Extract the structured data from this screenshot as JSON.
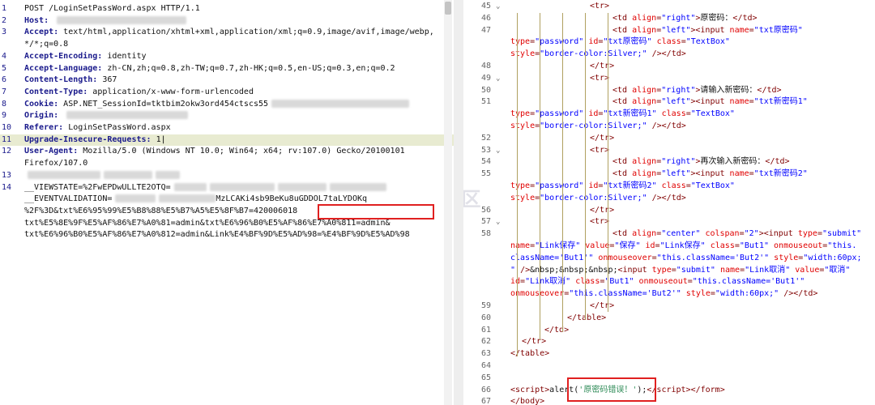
{
  "request": {
    "lines": [
      {
        "n": "1",
        "segments": [
          {
            "k": "",
            "v": "POST /LoginSetPassWord.aspx HTTP/1.1"
          }
        ]
      },
      {
        "n": "2",
        "segments": [
          {
            "k": "Host: ",
            "v": ""
          }
        ]
      },
      {
        "n": "3",
        "segments": [
          {
            "k": "Accept: ",
            "v": "text/html,application/xhtml+xml,application/xml;q=0.9,image/avif,image/webp,"
          }
        ]
      },
      {
        "n": "",
        "segments": [
          {
            "k": "",
            "v": "*/*;q=0.8"
          }
        ]
      },
      {
        "n": "4",
        "segments": [
          {
            "k": "Accept-Encoding: ",
            "v": "identity"
          }
        ]
      },
      {
        "n": "5",
        "segments": [
          {
            "k": "Accept-Language: ",
            "v": "zh-CN,zh;q=0.8,zh-TW;q=0.7,zh-HK;q=0.5,en-US;q=0.3,en;q=0.2"
          }
        ]
      },
      {
        "n": "6",
        "segments": [
          {
            "k": "Content-Length: ",
            "v": "367"
          }
        ]
      },
      {
        "n": "7",
        "segments": [
          {
            "k": "Content-Type: ",
            "v": "application/x-www-form-urlencoded"
          }
        ]
      },
      {
        "n": "8",
        "segments": [
          {
            "k": "Cookie: ",
            "v": "ASP.NET_SessionId=tktbim2okw3ord454ctscs55"
          }
        ]
      },
      {
        "n": "9",
        "segments": [
          {
            "k": "Origin: ",
            "v": ""
          }
        ]
      },
      {
        "n": "10",
        "segments": [
          {
            "k": "Referer: ",
            "v": ""
          }
        ],
        "suffix": "LoginSetPassWord.aspx"
      },
      {
        "n": "11",
        "segments": [
          {
            "k": "Upgrade-Insecure-Requests: ",
            "v": "1"
          }
        ],
        "highlight": true
      },
      {
        "n": "12",
        "segments": [
          {
            "k": "User-Agent: ",
            "v": "Mozilla/5.0 (Windows NT 10.0; Win64; x64; rv:107.0) Gecko/20100101"
          }
        ]
      },
      {
        "n": "",
        "segments": [
          {
            "k": "",
            "v": "Firefox/107.0"
          }
        ]
      },
      {
        "n": "13",
        "segments": [
          {
            "k": "",
            "v": ""
          }
        ]
      },
      {
        "n": "14",
        "segments": [
          {
            "k": "",
            "v": "__VIEWSTATE=%2FwEPDwULLTE2OTQ="
          }
        ]
      },
      {
        "n": "",
        "segments": [
          {
            "k": "",
            "v": "__EVENTVALIDATION="
          }
        ],
        "suffix": "MzLCAKi4sb9BeKu8uGDDOL7taLYDOKq"
      },
      {
        "n": "",
        "segments": [
          {
            "k": "",
            "v": "%2F"
          }
        ],
        "suffix": "%3D&txt%E6%95%99%E5%B8%88%E5%B7%A5%E5%8F%B7=420006018"
      },
      {
        "n": "",
        "segments": [
          {
            "k": "",
            "v": "txt%E5%8E%9F%E5%AF%86%E7%A0%81=admin&txt%E6%96%B0%E5%AF%86%E7%A0%811=admin&"
          }
        ]
      },
      {
        "n": "",
        "segments": [
          {
            "k": "",
            "v": "txt%E6%96%B0%E5%AF%86%E7%A0%812=admin&Link%E4%BF%9D%E5%AD%98=%E4%BF%9D%E5%AD%98"
          }
        ]
      }
    ]
  },
  "code": {
    "lines": [
      {
        "n": "45",
        "fold": "⌄",
        "html": "<span class='tag'>&lt;tr&gt;</span>",
        "indent": 7
      },
      {
        "n": "46",
        "fold": "",
        "html": "<span class='tag'>&lt;td</span> <span class='attr'>align</span>=<span class='aval'>\"right\"</span><span class='tag'>&gt;</span><span class='txtc'>原密码：</span><span class='tag'>&lt;/td&gt;</span>",
        "indent": 9
      },
      {
        "n": "47",
        "fold": "",
        "html": "<span class='tag'>&lt;td</span> <span class='attr'>align</span>=<span class='aval'>\"left\"</span><span class='tag'>&gt;&lt;input</span> <span class='attr'>name</span>=<span class='aval'>\"txt原密码\"</span>",
        "indent": 9
      },
      {
        "n": "",
        "fold": "",
        "html": "<span class='attr'>type</span>=<span class='aval'>\"password\"</span> <span class='attr'>id</span>=<span class='aval'>\"txt原密码\"</span> <span class='attr'>class</span>=<span class='aval'>\"TextBox\"</span>",
        "indent": 0
      },
      {
        "n": "",
        "fold": "",
        "html": "<span class='attr'>style</span>=<span class='aval'>\"border-color:Silver;\"</span> <span class='tag'>/&gt;&lt;/td&gt;</span>",
        "indent": 0
      },
      {
        "n": "48",
        "fold": "",
        "html": "<span class='tag'>&lt;/tr&gt;</span>",
        "indent": 7
      },
      {
        "n": "49",
        "fold": "⌄",
        "html": "<span class='tag'>&lt;tr&gt;</span>",
        "indent": 7
      },
      {
        "n": "50",
        "fold": "",
        "html": "<span class='tag'>&lt;td</span> <span class='attr'>align</span>=<span class='aval'>\"right\"</span><span class='tag'>&gt;</span><span class='txtc'>请输入新密码：</span><span class='tag'>&lt;/td&gt;</span>",
        "indent": 9
      },
      {
        "n": "51",
        "fold": "",
        "html": "<span class='tag'>&lt;td</span> <span class='attr'>align</span>=<span class='aval'>\"left\"</span><span class='tag'>&gt;&lt;input</span> <span class='attr'>name</span>=<span class='aval'>\"txt新密码1\"</span>",
        "indent": 9
      },
      {
        "n": "",
        "fold": "",
        "html": "<span class='attr'>type</span>=<span class='aval'>\"password\"</span> <span class='attr'>id</span>=<span class='aval'>\"txt新密码1\"</span> <span class='attr'>class</span>=<span class='aval'>\"TextBox\"</span>",
        "indent": 0
      },
      {
        "n": "",
        "fold": "",
        "html": "<span class='attr'>style</span>=<span class='aval'>\"border-color:Silver;\"</span> <span class='tag'>/&gt;&lt;/td&gt;</span>",
        "indent": 0
      },
      {
        "n": "52",
        "fold": "",
        "html": "<span class='tag'>&lt;/tr&gt;</span>",
        "indent": 7
      },
      {
        "n": "53",
        "fold": "⌄",
        "html": "<span class='tag'>&lt;tr&gt;</span>",
        "indent": 7
      },
      {
        "n": "54",
        "fold": "",
        "html": "<span class='tag'>&lt;td</span> <span class='attr'>align</span>=<span class='aval'>\"right\"</span><span class='tag'>&gt;</span><span class='txtc'>再次输入新密码：</span><span class='tag'>&lt;/td&gt;</span>",
        "indent": 9
      },
      {
        "n": "55",
        "fold": "",
        "html": "<span class='tag'>&lt;td</span> <span class='attr'>align</span>=<span class='aval'>\"left\"</span><span class='tag'>&gt;&lt;input</span> <span class='attr'>name</span>=<span class='aval'>\"txt新密码2\"</span>",
        "indent": 9
      },
      {
        "n": "",
        "fold": "",
        "html": "<span class='attr'>type</span>=<span class='aval'>\"password\"</span> <span class='attr'>id</span>=<span class='aval'>\"txt新密码2\"</span> <span class='attr'>class</span>=<span class='aval'>\"TextBox\"</span>",
        "indent": 0
      },
      {
        "n": "",
        "fold": "",
        "html": "<span class='attr'>style</span>=<span class='aval'>\"border-color:Silver;\"</span> <span class='tag'>/&gt;&lt;/td&gt;</span>",
        "indent": 0
      },
      {
        "n": "56",
        "fold": "",
        "html": "<span class='tag'>&lt;/tr&gt;</span>",
        "indent": 7
      },
      {
        "n": "57",
        "fold": "⌄",
        "html": "<span class='tag'>&lt;tr&gt;</span>",
        "indent": 7
      },
      {
        "n": "58",
        "fold": "",
        "html": "<span class='tag'>&lt;td</span> <span class='attr'>align</span>=<span class='aval'>\"center\"</span> <span class='attr'>colspan</span>=<span class='aval'>\"2\"</span><span class='tag'>&gt;&lt;input</span> <span class='attr'>type</span>=<span class='aval'>\"submit\"</span>",
        "indent": 9
      },
      {
        "n": "",
        "fold": "",
        "html": "<span class='attr'>name</span>=<span class='aval'>\"Link保存\"</span> <span class='attr'>value</span>=<span class='aval'>\"保存\"</span> <span class='attr'>id</span>=<span class='aval'>\"Link保存\"</span> <span class='attr'>class</span>=<span class='aval'>\"But1\"</span> <span class='attr'>onmouseout</span>=<span class='aval'>\"this.</span>",
        "indent": 0
      },
      {
        "n": "",
        "fold": "",
        "html": "<span class='aval'>className='But1'\"</span> <span class='attr'>onmouseover</span>=<span class='aval'>\"this.className='But2'\"</span> <span class='attr'>style</span>=<span class='aval'>\"width:60px;</span>",
        "indent": 0
      },
      {
        "n": "",
        "fold": "",
        "html": "<span class='aval'>\"</span> <span class='tag'>/&gt;</span><span class='txtc'>&amp;nbsp;&amp;nbsp;&amp;nbsp;</span><span class='tag'>&lt;input</span> <span class='attr'>type</span>=<span class='aval'>\"submit\"</span> <span class='attr'>name</span>=<span class='aval'>\"Link取消\"</span> <span class='attr'>value</span>=<span class='aval'>\"取消\"</span>",
        "indent": 0
      },
      {
        "n": "",
        "fold": "",
        "html": "<span class='attr'>id</span>=<span class='aval'>\"Link取消\"</span> <span class='attr'>class</span>=<span class='aval'>\"But1\"</span> <span class='attr'>onmouseout</span>=<span class='aval'>\"this.className='But1'\"</span>",
        "indent": 0
      },
      {
        "n": "",
        "fold": "",
        "html": "<span class='attr'>onmouseover</span>=<span class='aval'>\"this.className='But2'\"</span> <span class='attr'>style</span>=<span class='aval'>\"width:60px;\"</span> <span class='tag'>/&gt;&lt;/td&gt;</span>",
        "indent": 0
      },
      {
        "n": "59",
        "fold": "",
        "html": "<span class='tag'>&lt;/tr&gt;</span>",
        "indent": 7
      },
      {
        "n": "60",
        "fold": "",
        "html": "<span class='tag'>&lt;/table&gt;</span>",
        "indent": 5
      },
      {
        "n": "61",
        "fold": "",
        "html": "<span class='tag'>&lt;/td&gt;</span>",
        "indent": 3
      },
      {
        "n": "62",
        "fold": "",
        "html": "<span class='tag'>&lt;/tr&gt;</span>",
        "indent": 1
      },
      {
        "n": "63",
        "fold": "",
        "html": "<span class='tag'>&lt;/table&gt;</span>",
        "indent": 0
      },
      {
        "n": "64",
        "fold": "",
        "html": "",
        "indent": 0
      },
      {
        "n": "65",
        "fold": "",
        "html": "",
        "indent": 0
      },
      {
        "n": "66",
        "fold": "",
        "html": "<span class='tag'>&lt;script&gt;</span><span class='txtc'>alert(</span><span class='aval' style='color:#2e8b57'>'原密码错误！'</span><span class='txtc'>);</span><span class='tag'>&lt;/script&gt;&lt;/form&gt;</span>",
        "indent": 0
      },
      {
        "n": "67",
        "fold": "",
        "html": "<span class='tag'>&lt;/body&gt;</span>",
        "indent": 0
      }
    ]
  },
  "watermark": "· 嘉宾策攻防社区",
  "colors": {
    "highlight": "#e8ebd1",
    "redbox": "#e02020",
    "keyword": "#1a1a8c"
  }
}
